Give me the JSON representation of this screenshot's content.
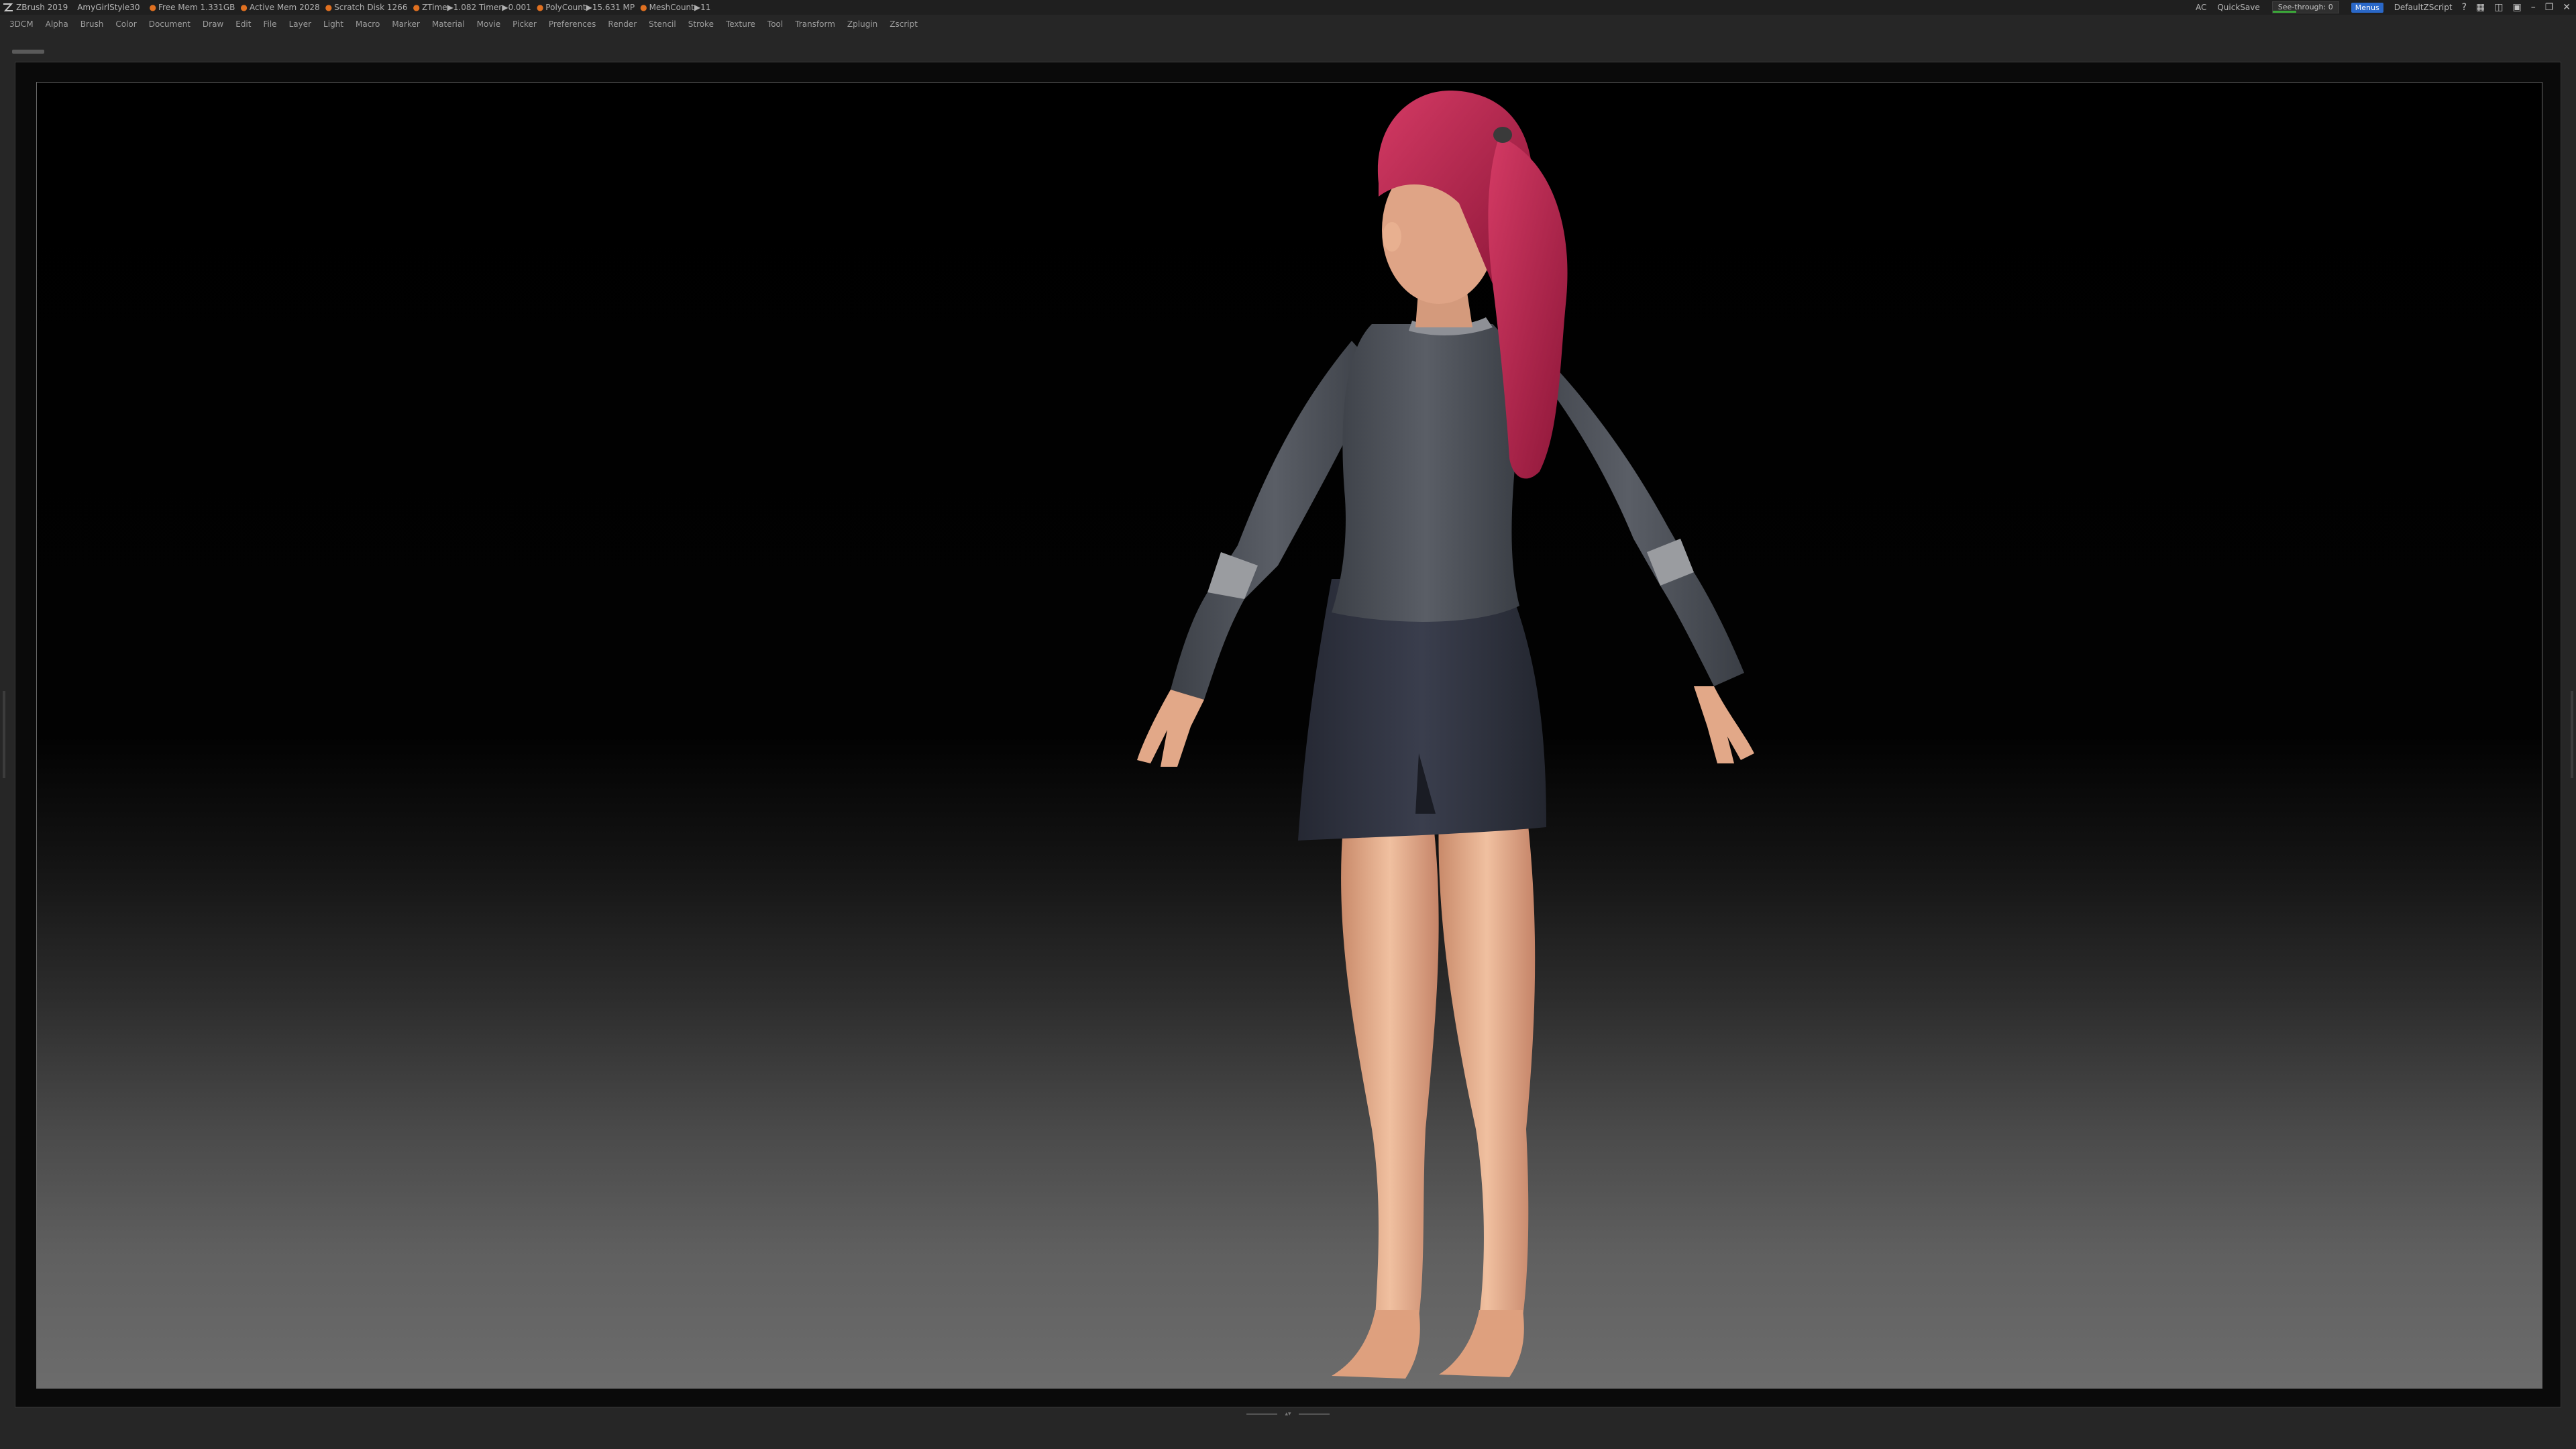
{
  "titlebar": {
    "app_name": "ZBrush 2019",
    "document": "AmyGirlStyle30",
    "stats": [
      "Free Mem 1.331GB",
      "Active Mem 2028",
      "Scratch Disk 1266",
      "ZTime▶1.082 Timer▶0.001",
      "PolyCount▶15.631 MP",
      "MeshCount▶11"
    ],
    "ac_label": "AC",
    "quicksave_label": "QuickSave",
    "see_through_label": "See-through",
    "see_through_value": "0",
    "menus_label": "Menus",
    "script_label": "DefaultZScript"
  },
  "menubar": {
    "items": [
      "3DCM",
      "Alpha",
      "Brush",
      "Color",
      "Document",
      "Draw",
      "Edit",
      "File",
      "Layer",
      "Light",
      "Macro",
      "Marker",
      "Material",
      "Movie",
      "Picker",
      "Preferences",
      "Render",
      "Stencil",
      "Stroke",
      "Texture",
      "Tool",
      "Transform",
      "Zplugin",
      "Zscript"
    ]
  },
  "icons": {
    "app_logo": "zbrush-logo-icon",
    "bottom_handle": "collapse-arrows-icon"
  },
  "colors": {
    "accent_blue": "#2a68c8",
    "stat_dot": "#e07020",
    "see_through_bar": "#3aa838",
    "hair": "#b0204a",
    "sweater": "#4a4e55",
    "skirt": "#2e3240",
    "skin": "#e8b090"
  }
}
